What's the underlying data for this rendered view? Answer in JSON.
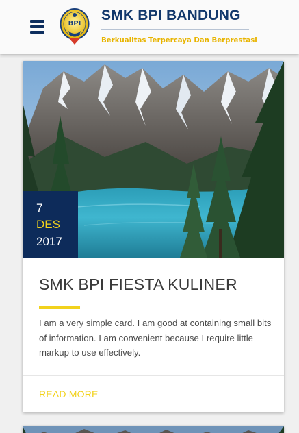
{
  "header": {
    "school_name": "SMK BPI BANDUNG",
    "tagline": "Berkualitas Terpercaya Dan Berprestasi",
    "logo_text": "BPI",
    "menu_icon": "hamburger-icon"
  },
  "cards": [
    {
      "date": {
        "day": "7",
        "month": "DES",
        "year": "2017"
      },
      "title": "SMK BPI FIESTA KULINER",
      "text": "I am a very simple card. I am good at containing small bits of information. I am convenient because I require little markup to use effectively.",
      "action": "READ MORE"
    }
  ],
  "colors": {
    "primary": "#12386c",
    "accent": "#f2d21c",
    "badge_bg": "#0d2b5a",
    "background": "#f0f0f0"
  }
}
